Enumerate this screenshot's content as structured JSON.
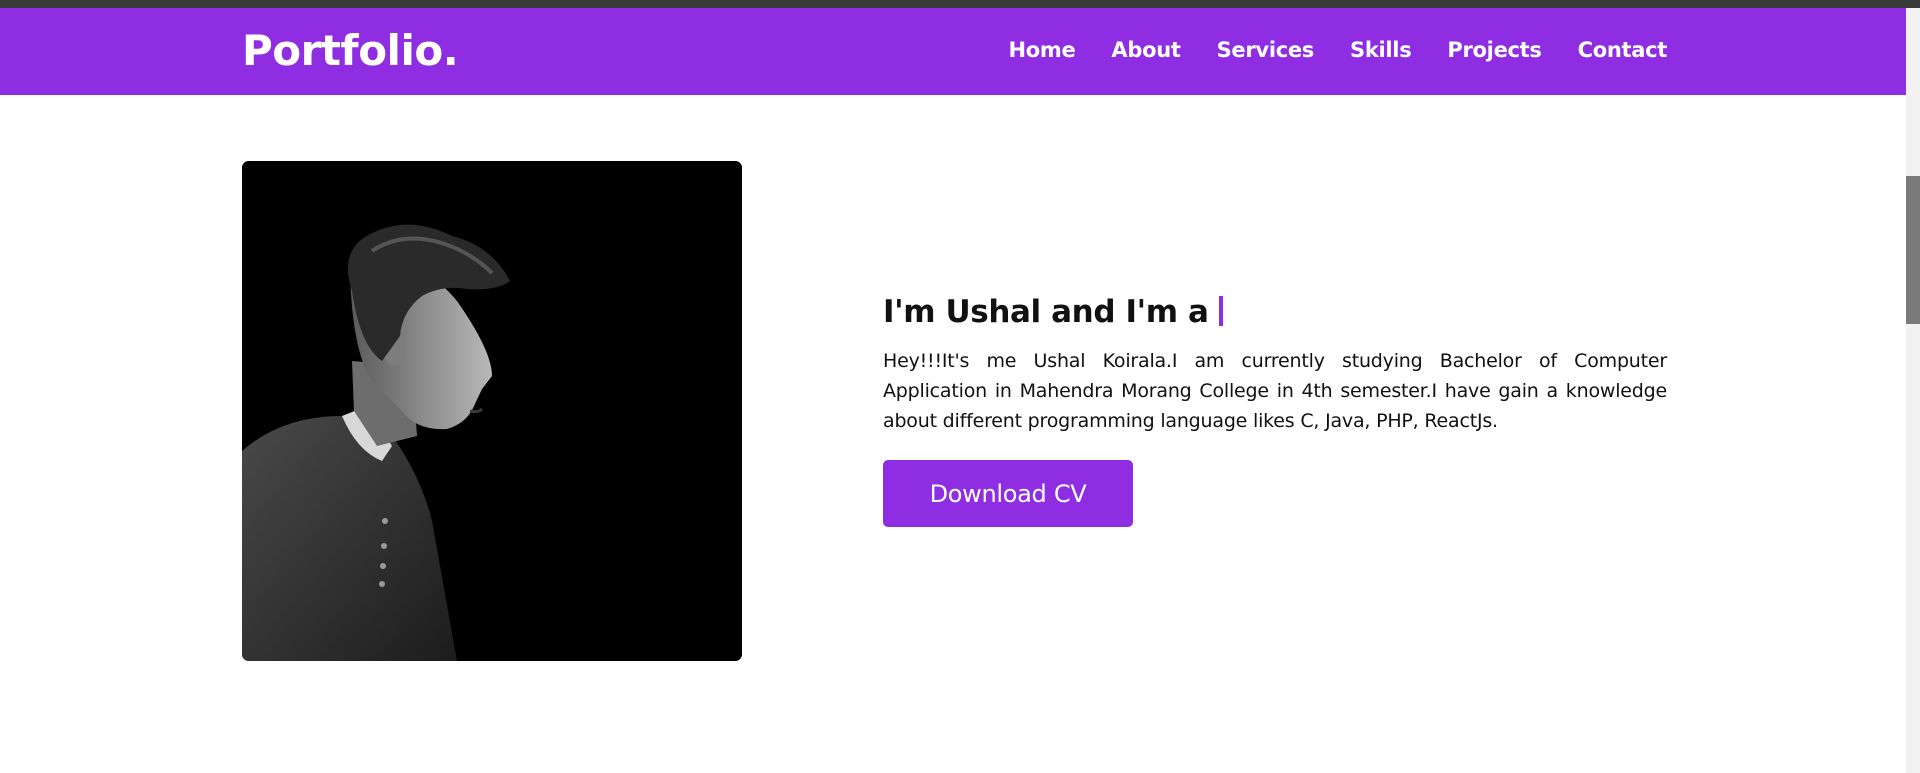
{
  "nav": {
    "logo": "Portfolio.",
    "links": [
      {
        "label": "Home"
      },
      {
        "label": "About"
      },
      {
        "label": "Services"
      },
      {
        "label": "Skills"
      },
      {
        "label": "Projects"
      },
      {
        "label": "Contact"
      }
    ]
  },
  "hero": {
    "headline": "I'm Ushal and I'm a",
    "description": "Hey!!!It's me Ushal Koirala.I am currently studying Bachelor of Computer Application in Mahendra Morang College in 4th semester.I have gain a knowledge about different programming language likes C, Java, PHP, ReactJs.",
    "button_label": "Download CV"
  },
  "colors": {
    "brand": "#8e2de2",
    "topstrip": "#3a3a3a",
    "text": "#111111",
    "background": "#ffffff"
  }
}
